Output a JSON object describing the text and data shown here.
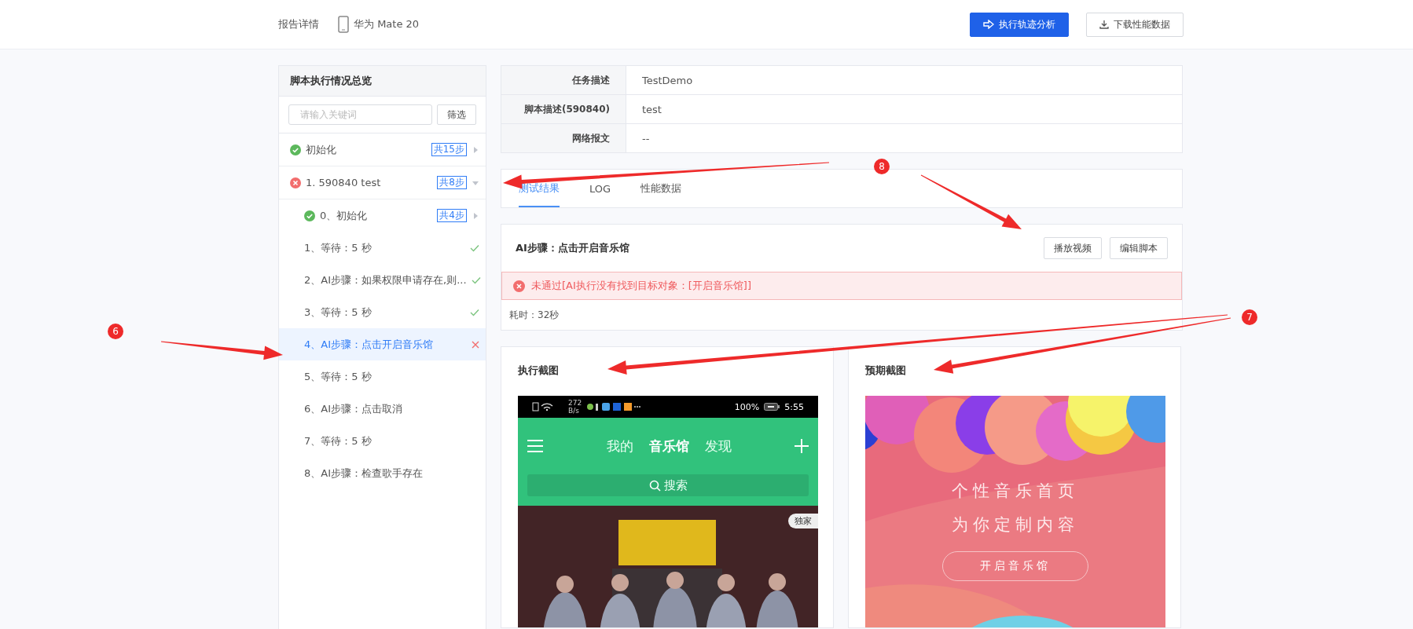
{
  "header": {
    "title": "报告详情",
    "device": "华为 Mate 20",
    "buttons": [
      {
        "label": "执行轨迹分析",
        "kind": "primary"
      },
      {
        "label": "下载性能数据",
        "kind": "default"
      }
    ]
  },
  "sidebar": {
    "title": "脚本执行情况总览",
    "search": {
      "placeholder": "请输入关键词"
    },
    "filter_button": "筛选",
    "items": [
      {
        "kind": "group",
        "label": "初始化",
        "passed": true,
        "badge": "共15步",
        "expanded": false,
        "selected": false
      },
      {
        "kind": "group",
        "label": "1. 590840 test",
        "passed": false,
        "badge": "共8步",
        "expanded": true,
        "selected": false,
        "children": [
          {
            "kind": "group",
            "label": "0、初始化",
            "passed": true,
            "badge": "共4步",
            "expanded": false,
            "selected": false
          },
          {
            "kind": "step",
            "label": "1、等待：5 秒",
            "passed": true,
            "selected": false
          },
          {
            "kind": "step",
            "label": "2、AI步骤：如果权限申请存在,则...",
            "passed": true,
            "selected": false
          },
          {
            "kind": "step",
            "label": "3、等待：5 秒",
            "passed": true,
            "selected": false
          },
          {
            "kind": "step",
            "label": "4、AI步骤：点击开启音乐馆",
            "passed": false,
            "selected": true
          },
          {
            "kind": "step",
            "label": "5、等待：5 秒",
            "selected": false
          },
          {
            "kind": "step",
            "label": "6、AI步骤：点击取消",
            "selected": false
          },
          {
            "kind": "step",
            "label": "7、等待：5 秒",
            "selected": false
          },
          {
            "kind": "step",
            "label": "8、AI步骤：检查歌手存在",
            "selected": false
          }
        ]
      }
    ]
  },
  "info_table": {
    "rows": [
      {
        "label": "任务描述",
        "value": "TestDemo"
      },
      {
        "label": "脚本描述(590840)",
        "value": "test"
      },
      {
        "label": "网络报文",
        "value": "--"
      }
    ]
  },
  "tabs": [
    {
      "label": "测试结果",
      "selected": true
    },
    {
      "label": "LOG",
      "selected": false
    },
    {
      "label": "性能数据",
      "selected": false
    }
  ],
  "step_card": {
    "title": "AI步骤：点击开启音乐馆",
    "buttons": [
      "播放视频",
      "编辑脚本"
    ],
    "error": "未通过[AI执行没有找到目标对象：[开启音乐馆]]",
    "duration": "耗时：32秒"
  },
  "screenshots": [
    {
      "kind": "actual",
      "title": "执行截图",
      "status_bar": {
        "net_speed": [
          "272",
          "B/s"
        ],
        "battery": "100%",
        "time": "5:55"
      },
      "nav": [
        {
          "label": "我的",
          "selected": false
        },
        {
          "label": "音乐馆",
          "selected": true
        },
        {
          "label": "发现",
          "selected": false
        }
      ],
      "search": "搜索",
      "banner_badge": "独家"
    },
    {
      "kind": "expected",
      "title": "预期截图",
      "lines": [
        "个性音乐首页",
        "为你定制内容"
      ],
      "button": "开启音乐馆"
    }
  ],
  "annotations": [
    {
      "label": "8"
    },
    {
      "label": "7"
    },
    {
      "label": "6"
    }
  ]
}
